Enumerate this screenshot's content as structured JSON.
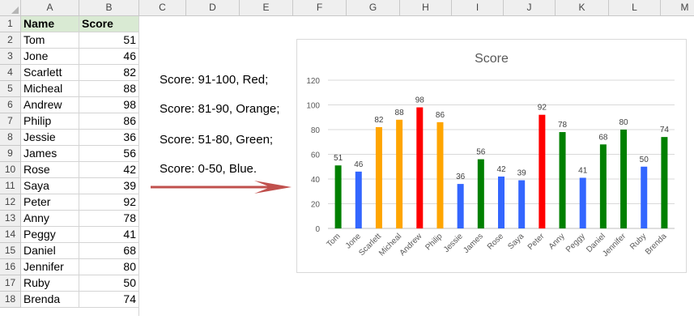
{
  "columns": [
    "A",
    "B",
    "C",
    "D",
    "E",
    "F",
    "G",
    "H",
    "I",
    "J",
    "K",
    "L",
    "M"
  ],
  "row_numbers": [
    "1",
    "2",
    "3",
    "4",
    "5",
    "6",
    "7",
    "8",
    "9",
    "10",
    "11",
    "12",
    "13",
    "14",
    "15",
    "16",
    "17",
    "18"
  ],
  "table": {
    "headers": [
      "Name",
      "Score"
    ],
    "rows": [
      [
        "Tom",
        "51"
      ],
      [
        "Jone",
        "46"
      ],
      [
        "Scarlett",
        "82"
      ],
      [
        "Micheal",
        "88"
      ],
      [
        "Andrew",
        "98"
      ],
      [
        "Philip",
        "86"
      ],
      [
        "Jessie",
        "36"
      ],
      [
        "James",
        "56"
      ],
      [
        "Rose",
        "42"
      ],
      [
        "Saya",
        "39"
      ],
      [
        "Peter",
        "92"
      ],
      [
        "Anny",
        "78"
      ],
      [
        "Peggy",
        "41"
      ],
      [
        "Daniel",
        "68"
      ],
      [
        "Jennifer",
        "80"
      ],
      [
        "Ruby",
        "50"
      ],
      [
        "Brenda",
        "74"
      ]
    ]
  },
  "rules": [
    "Score: 91-100, Red;",
    "Score: 81-90, Orange;",
    "Score: 51-80, Green;",
    "Score: 0-50, Blue."
  ],
  "colors": {
    "red": "#ff0000",
    "orange": "#ffa500",
    "green": "#008000",
    "blue": "#3366ff",
    "arrow": "#c0504d"
  },
  "chart_data": {
    "type": "bar",
    "title": "Score",
    "categories": [
      "Tom",
      "Jone",
      "Scarlett",
      "Micheal",
      "Andrew",
      "Philip",
      "Jessie",
      "James",
      "Rose",
      "Saya",
      "Peter",
      "Anny",
      "Peggy",
      "Daniel",
      "Jennifer",
      "Ruby",
      "Brenda"
    ],
    "values": [
      51,
      46,
      82,
      88,
      98,
      86,
      36,
      56,
      42,
      39,
      92,
      78,
      41,
      68,
      80,
      50,
      74
    ],
    "bar_colors": [
      "green",
      "blue",
      "orange",
      "orange",
      "red",
      "orange",
      "blue",
      "green",
      "blue",
      "blue",
      "red",
      "green",
      "blue",
      "green",
      "green",
      "blue",
      "green"
    ],
    "ylim": [
      0,
      120
    ],
    "yticks": [
      "0",
      "20",
      "40",
      "60",
      "80",
      "100",
      "120"
    ],
    "grid": true,
    "data_labels": true
  }
}
